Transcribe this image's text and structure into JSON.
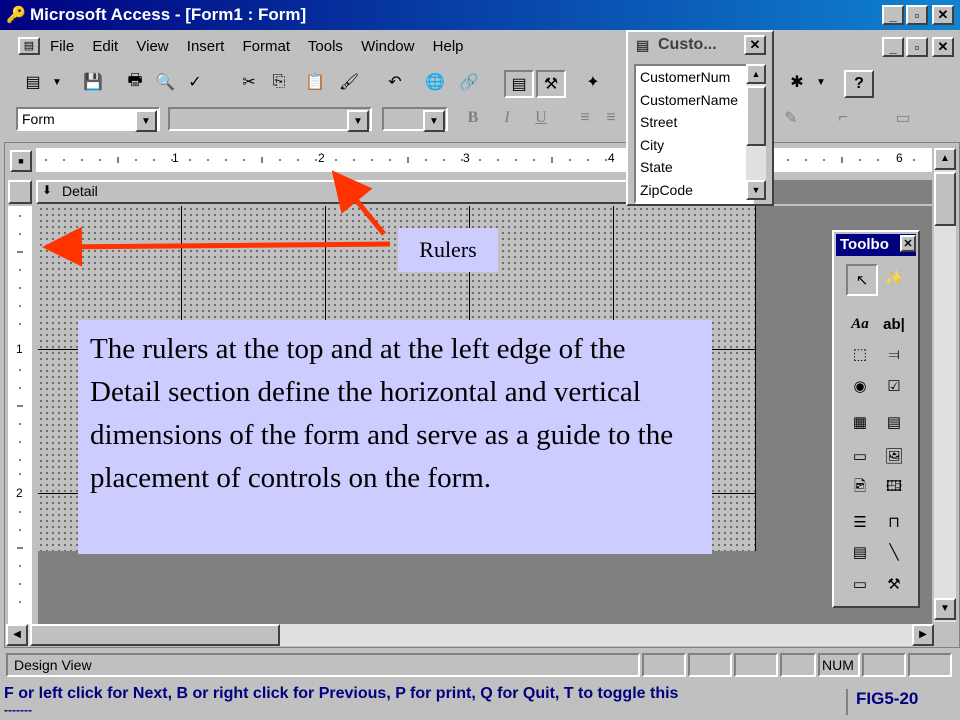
{
  "window": {
    "title": "Microsoft Access - [Form1 : Form]",
    "buttons": {
      "minimize": "_",
      "restore": "▫",
      "close": "✕"
    }
  },
  "menu": [
    "File",
    "Edit",
    "View",
    "Insert",
    "Format",
    "Tools",
    "Window",
    "Help"
  ],
  "formatting": {
    "object_combo": "Form",
    "font_combo": "",
    "size_combo": ""
  },
  "field_list": {
    "title": "Custo...",
    "fields": [
      "CustomerNum",
      "CustomerName",
      "Street",
      "City",
      "State",
      "ZipCode"
    ]
  },
  "detail_section": {
    "header": "Detail"
  },
  "ruler": {
    "top_marks": [
      "1",
      "2",
      "3",
      "4",
      "6"
    ],
    "left_marks": [
      "1",
      "2"
    ]
  },
  "toolbox": {
    "title": "Toolbo",
    "tools": [
      "select-pointer",
      "control-wizards",
      "label",
      "text-box",
      "option-group",
      "toggle-button",
      "option-button",
      "check-box",
      "combo-box",
      "list-box",
      "command-button",
      "image",
      "unbound-object-frame",
      "bound-object-frame",
      "page-break",
      "tab-control",
      "subform",
      "line",
      "rectangle",
      "more-controls"
    ]
  },
  "callout": {
    "text": "The rulers at the top and at the left edge of the Detail section define the horizontal and vertical dimensions of the form and serve as a guide to the placement of controls on the form.",
    "label": "Rulers"
  },
  "status": {
    "mode": "Design View",
    "num": "NUM"
  },
  "bottom": {
    "instructions": "F or left click for Next, B or right click for Previous, P for print, Q for Quit, T to toggle this",
    "trailing": "-------",
    "figure": "FIG5-20"
  },
  "colors": {
    "title_bar": "#000080",
    "callout_bg": "#ccccff",
    "arrow": "#ff3300"
  }
}
